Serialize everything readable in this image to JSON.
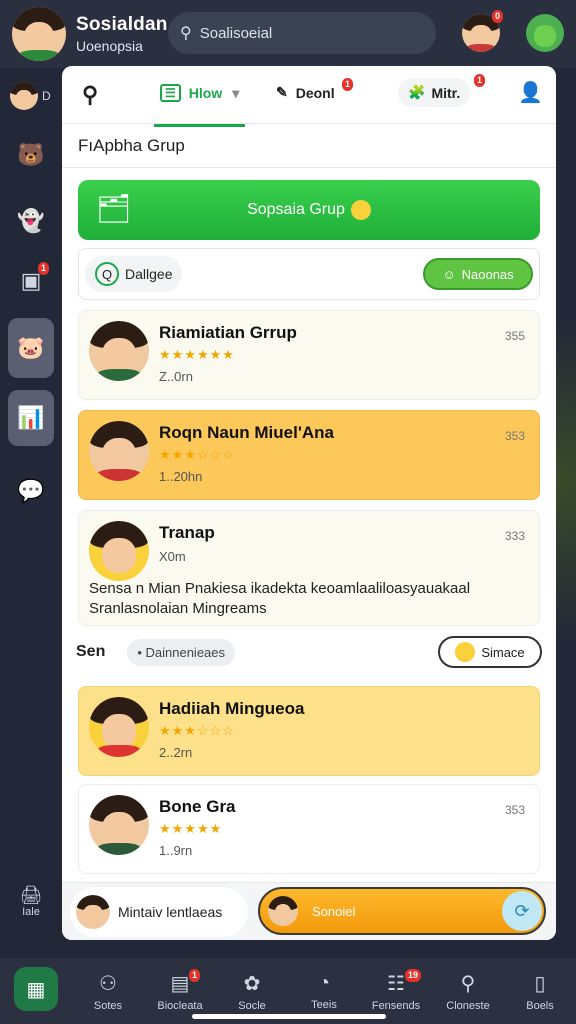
{
  "header": {
    "title": "Sosialdan",
    "subtitle": "Uoenopsia",
    "search_placeholder": "Soalisoeial",
    "notif_badge": "0"
  },
  "rail": {
    "profile_label": "D",
    "badge": "1",
    "bottom_label": "Iale"
  },
  "tabs": {
    "home": "Hlow",
    "discover": "Deonl",
    "discover_badge": "1",
    "more": "Mitr.",
    "more_badge": "1"
  },
  "group_title": "FıApbha Grup",
  "join_button": "Sopsaia Grup",
  "filter": {
    "label": "Dallgee",
    "action": "Naoonas"
  },
  "cards": [
    {
      "name": "Riamiatian Grrup",
      "stars": "★★★★★★",
      "meta": "Z..0rn",
      "num": "355"
    },
    {
      "name": "Roqn Naun Miuel'Ana",
      "stars": "★★★☆☆☆",
      "meta": "1..20hn",
      "num": "353"
    },
    {
      "name": "Tranap",
      "meta": "X0m",
      "num": "333",
      "desc": "Sensa n Mian Pnakiesa ikadekta keoamlaaliloasyauakaal Sranlasnolaian Mingreams"
    },
    {
      "name": "Hadiiah Mingueoa",
      "stars": "★★★☆☆☆",
      "meta": "2..2rn"
    },
    {
      "name": "Bone Gra",
      "stars": "★★★★★",
      "meta": "1..9rn",
      "num": "353"
    }
  ],
  "section": {
    "label": "Sen",
    "chip": "• Dainnenieaes",
    "btn": "Simace"
  },
  "footer": {
    "left": "Mintaiv lentlaeas",
    "right": "Sonoiel"
  },
  "nav": [
    {
      "label": "",
      "badge": ""
    },
    {
      "label": "Sotes",
      "badge": ""
    },
    {
      "label": "Biocleata",
      "badge": "1"
    },
    {
      "label": "Socle",
      "badge": ""
    },
    {
      "label": "Teeis",
      "badge": ""
    },
    {
      "label": "Fensends",
      "badge": "19"
    },
    {
      "label": "Cloneste",
      "badge": ""
    },
    {
      "label": "Boels",
      "badge": ""
    }
  ],
  "colors": {
    "accent": "#1aa84a",
    "orange": "#fcc85a",
    "yellow": "#fde08a",
    "header": "#2a3040"
  }
}
